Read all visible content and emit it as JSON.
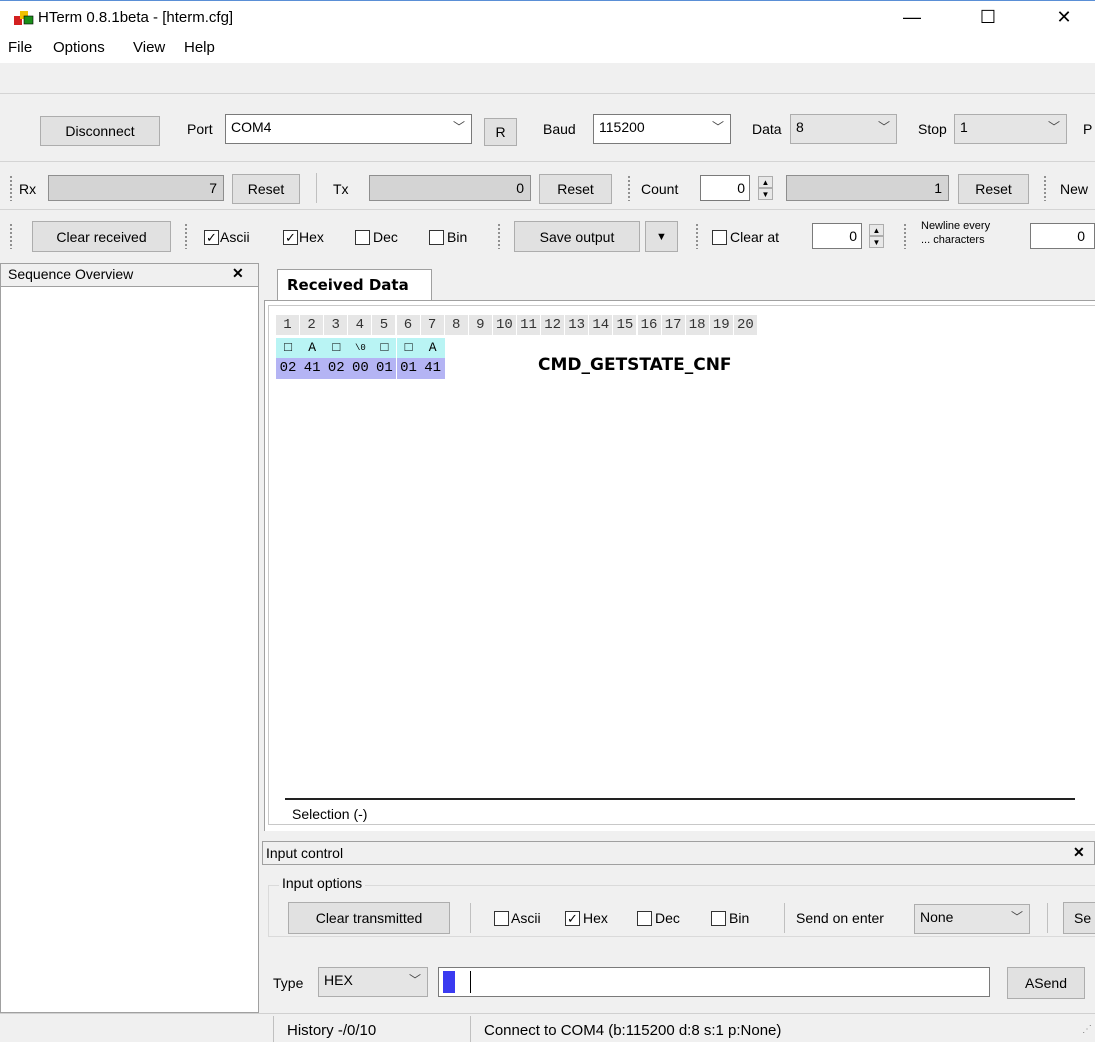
{
  "window": {
    "title": "HTerm 0.8.1beta - [hterm.cfg]",
    "minimize": "—",
    "maximize": "☐",
    "close": "✕"
  },
  "menu": [
    "File",
    "Options",
    "View",
    "Help"
  ],
  "connection": {
    "disconnect_label": "Disconnect",
    "port_label": "Port",
    "port_value": "COM4",
    "r_label": "R",
    "baud_label": "Baud",
    "baud_value": "115200",
    "data_label": "Data",
    "data_value": "8",
    "stop_label": "Stop",
    "stop_value": "1",
    "parity_label": "P"
  },
  "counters": {
    "rx_label": "Rx",
    "rx_value": "7",
    "rx_reset": "Reset",
    "tx_label": "Tx",
    "tx_value": "0",
    "tx_reset": "Reset",
    "count_label": "Count",
    "count_value": "0",
    "count_field": "1",
    "count_reset": "Reset",
    "newline_label": "New"
  },
  "display_options": {
    "clear_received": "Clear received",
    "ascii": "Ascii",
    "hex": "Hex",
    "dec": "Dec",
    "bin": "Bin",
    "ascii_checked": true,
    "hex_checked": true,
    "dec_checked": false,
    "bin_checked": false,
    "save_output": "Save output",
    "clear_at_label": "Clear at",
    "clear_at_value": "0",
    "newline_every_line1": "Newline every",
    "newline_every_line2": "... characters",
    "newline_every_value": "0"
  },
  "sequence_overview": {
    "title": "Sequence Overview",
    "close": "✕"
  },
  "received": {
    "tab": "Received Data",
    "columns": [
      "1",
      "2",
      "3",
      "4",
      "5",
      "6",
      "7",
      "8",
      "9",
      "10",
      "11",
      "12",
      "13",
      "14",
      "15",
      "16",
      "17",
      "18",
      "19",
      "20"
    ],
    "ascii_row": [
      "□",
      "A",
      "□",
      "\\0",
      "□",
      "□",
      "A"
    ],
    "hex_row": [
      "02",
      "41",
      "02",
      "00",
      "01",
      "01",
      "41"
    ],
    "annotation": "CMD_GETSTATE_CNF",
    "selection": "Selection (-)"
  },
  "input_control": {
    "title": "Input control",
    "close": "✕",
    "options_title": "Input options",
    "clear_transmitted": "Clear transmitted",
    "ascii": "Ascii",
    "hex": "Hex",
    "dec": "Dec",
    "bin": "Bin",
    "ascii_checked": false,
    "hex_checked": true,
    "dec_checked": false,
    "bin_checked": false,
    "send_on_enter_label": "Send on enter",
    "send_on_enter_value": "None",
    "se_label": "Se",
    "type_label": "Type",
    "type_value": "HEX",
    "input_value": "",
    "asend": "ASend"
  },
  "status": {
    "history": "History -/0/10",
    "message": "Connect to COM4 (b:115200 d:8 s:1 p:None)"
  },
  "colors": {
    "ascii_row_bg": "#b9f4f4",
    "hex_row_bg": "#b4b4f4",
    "header_cell_bg": "#e6e6e6",
    "caret_fill": "#3a3af0"
  }
}
